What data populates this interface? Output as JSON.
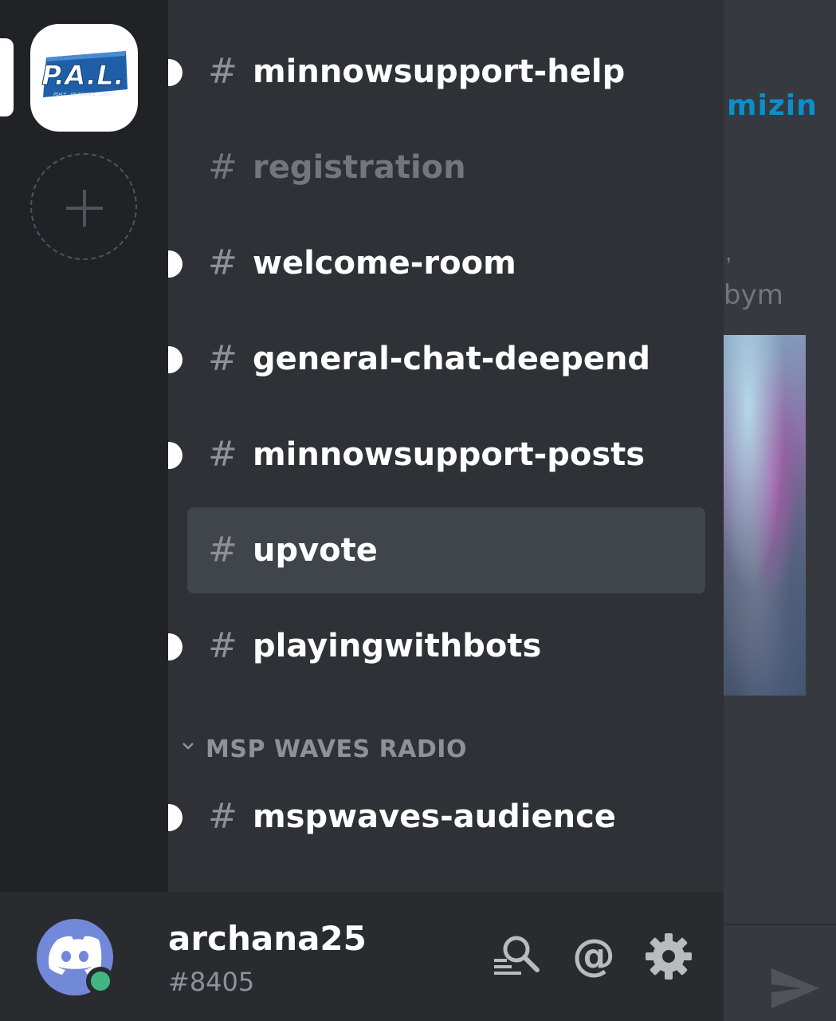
{
  "chat_background": {
    "fragment_top": "mizin",
    "fragment_comma": ",",
    "fragment_mid": "bym"
  },
  "server_rail": {
    "servers": [
      {
        "name": "PAL server",
        "icon": "pal-logo-icon",
        "logo_text": "P.A.L.",
        "logo_subtext": "PEACE · ABUNDANCE · LIBERTY"
      }
    ],
    "add_server_icon": "plus-icon"
  },
  "channels": [
    {
      "name": "minnowsupport-help",
      "unread": true,
      "selected": false,
      "muted": false
    },
    {
      "name": "registration",
      "unread": false,
      "selected": false,
      "muted": true
    },
    {
      "name": "welcome-room",
      "unread": true,
      "selected": false,
      "muted": false
    },
    {
      "name": "general-chat-deepend",
      "unread": true,
      "selected": false,
      "muted": false
    },
    {
      "name": "minnowsupport-posts",
      "unread": true,
      "selected": false,
      "muted": false
    },
    {
      "name": "upvote",
      "unread": false,
      "selected": true,
      "muted": false
    },
    {
      "name": "playingwithbots",
      "unread": true,
      "selected": false,
      "muted": false
    }
  ],
  "category": {
    "label": "MSP WAVES RADIO",
    "channels": [
      {
        "name": "mspwaves-audience",
        "unread": true
      }
    ]
  },
  "user_panel": {
    "username": "archana25",
    "discriminator": "#8405",
    "status": "online",
    "status_color": "#43b581",
    "avatar_color": "#7289da",
    "buttons": [
      "search-icon",
      "mention-icon",
      "gear-icon"
    ]
  },
  "colors": {
    "rail_bg": "#202225",
    "channels_bg": "#2f3136",
    "selected_bg": "#40444b",
    "panel_bg": "#292b2f"
  }
}
